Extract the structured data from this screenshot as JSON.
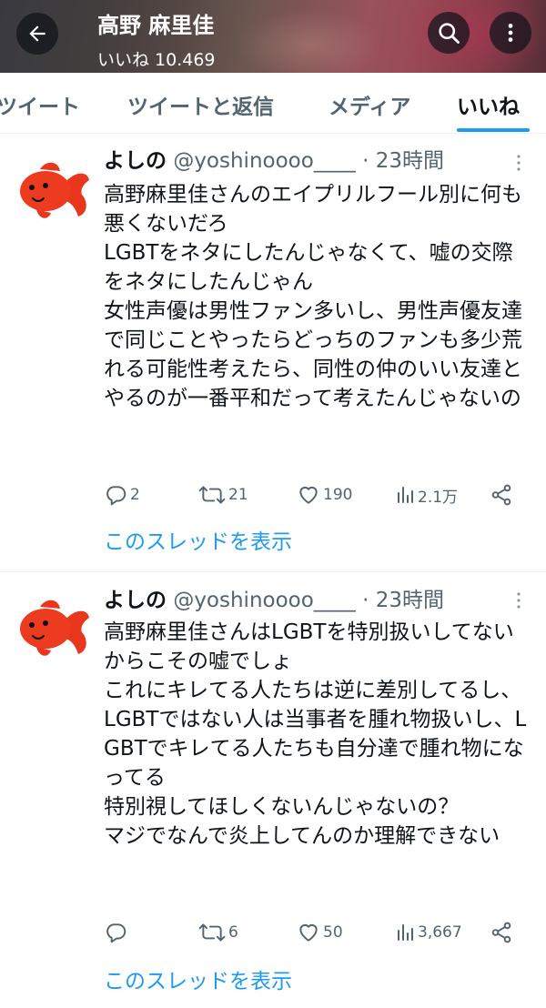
{
  "header": {
    "title": "高野 麻里佳",
    "likes_count": "いいね 10.469"
  },
  "tabs": [
    {
      "label": "ツイート",
      "active": false
    },
    {
      "label": "ツイートと返信",
      "active": false
    },
    {
      "label": "メディア",
      "active": false
    },
    {
      "label": "いいね",
      "active": true
    }
  ],
  "colors": {
    "accent": "#1d9bf0",
    "text": "#0f1419",
    "muted": "#536471",
    "avatar_fish": "#e8371d"
  },
  "tweets": [
    {
      "name": "よしの",
      "handle": "@yoshinoooo____",
      "time": "· 23時間",
      "text": "高野麻里佳さんのエイプリルフール別に何も悪くないだろ\nLGBTをネタにしたんじゃなくて、嘘の交際をネタにしたんじゃん\n女性声優は男性ファン多いし、男性声優友達で同じことやったらどっちのファンも多少荒れる可能性考えたら、同性の仲のいい友達とやるのが一番平和だって考えたんじゃないの",
      "replies": "2",
      "retweets": "21",
      "likes": "190",
      "views": "2.1万",
      "thread_link": "このスレッドを表示"
    },
    {
      "name": "よしの",
      "handle": "@yoshinoooo____",
      "time": "· 23時間",
      "text": "高野麻里佳さんはLGBTを特別扱いしてないからこその嘘でしょ\nこれにキレてる人たちは逆に差別してるし、LGBTではない人は当事者を腫れ物扱いし、LGBTでキレてる人たちも自分達で腫れ物になってる\n特別視してほしくないんじゃないの？\nマジでなんで炎上してんのか理解できない",
      "replies": "",
      "retweets": "6",
      "likes": "50",
      "views": "3,667",
      "thread_link": "このスレッドを表示"
    }
  ],
  "icons": {
    "back": "arrow-left-icon",
    "search": "search-icon",
    "more": "more-vertical-icon",
    "reply": "reply-icon",
    "retweet": "retweet-icon",
    "like": "heart-icon",
    "views": "views-bar-icon",
    "share": "share-icon",
    "caret": "more-vertical-icon"
  }
}
